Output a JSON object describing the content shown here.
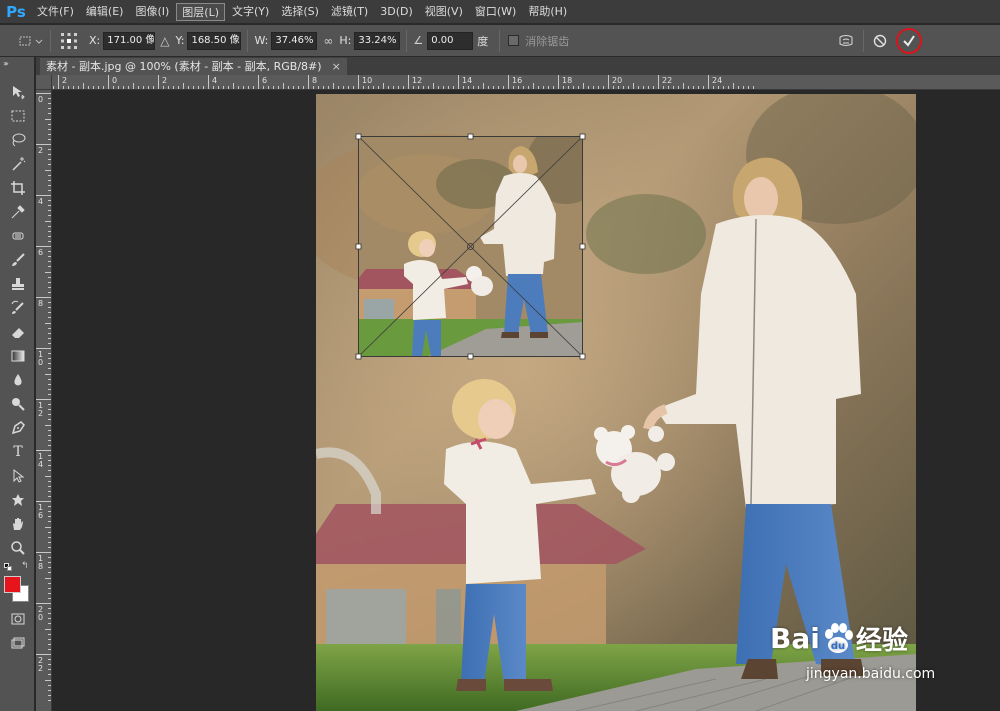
{
  "app": {
    "logo": "Ps"
  },
  "menu": {
    "items": [
      "文件(F)",
      "编辑(E)",
      "图像(I)",
      "图层(L)",
      "文字(Y)",
      "选择(S)",
      "滤镜(T)",
      "3D(D)",
      "视图(V)",
      "窗口(W)",
      "帮助(H)"
    ],
    "active_index": 3
  },
  "options": {
    "x_label": "X:",
    "x_value": "171.00 像",
    "y_label": "Y:",
    "y_value": "168.50 像",
    "w_label": "W:",
    "w_value": "37.46%",
    "h_label": "H:",
    "h_value": "33.24%",
    "angle_value": "0.00",
    "angle_unit": "度",
    "antialias_label": "消除锯齿",
    "antialias_checked": false,
    "commit_highlight_color": "#d9141b"
  },
  "document": {
    "tab_title": "素材 - 副本.jpg @ 100% (素材 - 副本 - 副本, RGB/8#)",
    "close_glyph": "×"
  },
  "rulers": {
    "top": [
      "0",
      "2",
      "0",
      "2",
      "4",
      "6",
      "8",
      "10",
      "12",
      "14",
      "16",
      "18",
      "20",
      "22",
      "24"
    ],
    "left": [
      "0",
      "2",
      "4",
      "6",
      "8",
      "1\n0",
      "1\n2",
      "1\n4",
      "1\n6",
      "1\n8",
      "2\n0",
      "2\n2"
    ]
  },
  "colors": {
    "foreground": "#e8141b",
    "background": "#ffffff"
  },
  "watermark": {
    "brand": "Bai",
    "brand_suffix": "du",
    "cn_text": "经验",
    "url": "jingyan.baidu.com"
  }
}
